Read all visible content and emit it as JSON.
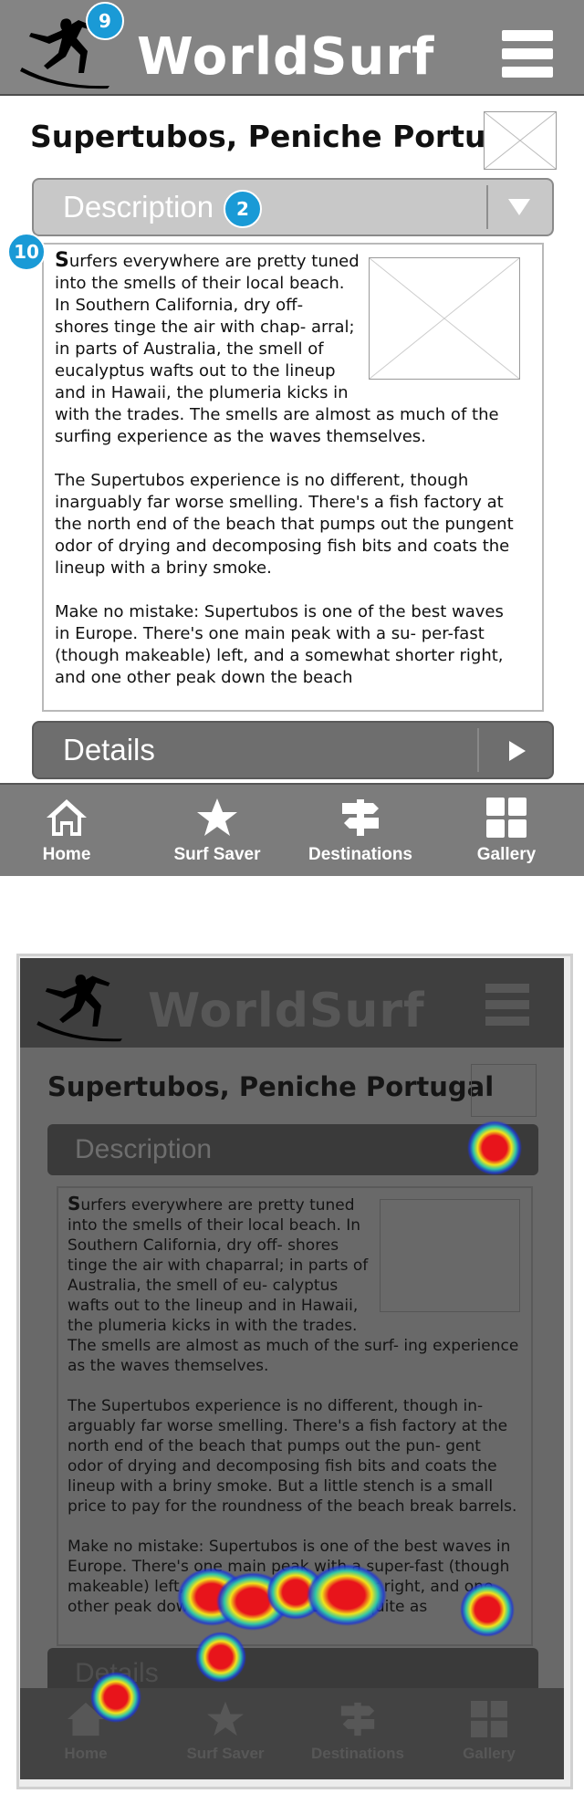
{
  "app": {
    "logo_text": "WorldSurf",
    "icons": {
      "menu": "hamburger-icon",
      "logo": "surfer-logo-icon"
    }
  },
  "annotations": {
    "logo_badge": "9",
    "description_badge": "2",
    "text_badge": "10"
  },
  "page": {
    "title": "Supertubos, Peniche Portugal"
  },
  "description": {
    "label": "Description",
    "toggle_icon": "triangle-down-icon",
    "lead_letter": "S",
    "paragraphs": [
      "urfers everywhere are pretty tuned into the smells of their local beach. In Southern California, dry off- shores tinge the air with chap- arral; in parts of Australia, the smell of eucalyptus wafts out to the lineup and in Hawaii, the plumeria kicks in with the trades. The smells are almost as much of the surfing experience as the waves themselves.",
      "The Supertubos experience is no different, though inarguably far worse smelling. There's a fish factory at the north end of the beach that pumps out the pungent odor of drying and decomposing fish bits and coats the lineup with a briny smoke.",
      "Make no mistake: Supertubos is one of the best waves in Europe. There's one main peak with a su- per-fast (though makeable) left, and a somewhat shorter right, and one other peak down the beach"
    ]
  },
  "details": {
    "label": "Details",
    "toggle_icon": "triangle-right-icon"
  },
  "bottom_nav": [
    {
      "label": "Home",
      "icon": "home-icon"
    },
    {
      "label": "Surf Saver",
      "icon": "star-icon"
    },
    {
      "label": "Destinations",
      "icon": "signpost-icon"
    },
    {
      "label": "Gallery",
      "icon": "grid-icon"
    }
  ],
  "heatmap_screen": {
    "logo_text": "WorldSurf",
    "title": "Supertubos, Peniche Portugal",
    "description_label": "Description",
    "lead_letter": "S",
    "paragraphs": [
      "urfers everywhere are pretty tuned into the smells of their local beach. In Southern California, dry off- shores tinge the air with chaparral; in parts of Australia, the smell of eu- calyptus wafts out to the lineup and in Hawaii, the plumeria kicks in with the trades. The smells are almost as much of the surf- ing experience as the waves themselves.",
      "The Supertubos experience is no different, though in- arguably far worse smelling. There's a fish factory at the north end of the beach that pumps out the pun- gent odor of drying and decomposing fish bits and coats the lineup with a briny smoke. But a little stench is a small price to pay for the roundness of the beach break barrels.",
      "Make no mistake: Supertubos is one of the best waves in Europe. There's one main peak with a super-fast (though makeable) left, and a somewhat shorter right, and one other peak down the beach that's not quite as"
    ],
    "details_label": "Details",
    "nav": [
      "Home",
      "Surf Saver",
      "Destinations",
      "Gallery"
    ],
    "heat_colors": {
      "core": "#e8141b",
      "mid": "#f2e31a",
      "edge": "#2fc6a6",
      "outer": "#1e36d8"
    }
  }
}
